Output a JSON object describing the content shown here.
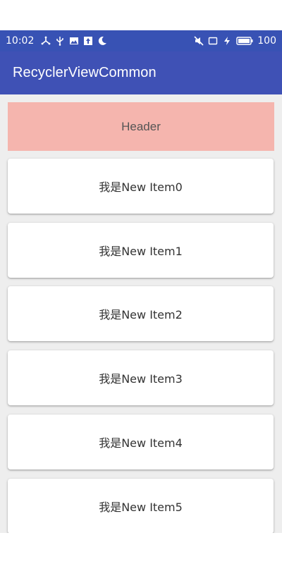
{
  "status_bar": {
    "time": "10:02",
    "battery": "100",
    "left_icons": [
      "usb-tether-icon",
      "usb-icon",
      "image-icon",
      "upload-icon",
      "moon-icon"
    ],
    "right_icons": [
      "mute-icon",
      "screen-icon",
      "charging-icon",
      "battery-icon"
    ],
    "color": "#3852b4"
  },
  "app_bar": {
    "title": "RecyclerViewCommon",
    "color": "#3f51b5"
  },
  "list": {
    "header": "Header",
    "header_color": "#f5b5ae",
    "items": [
      {
        "label": "我是New Item0"
      },
      {
        "label": "我是New Item1"
      },
      {
        "label": "我是New Item2"
      },
      {
        "label": "我是New Item3"
      },
      {
        "label": "我是New Item4"
      },
      {
        "label": "我是New Item5"
      }
    ]
  }
}
